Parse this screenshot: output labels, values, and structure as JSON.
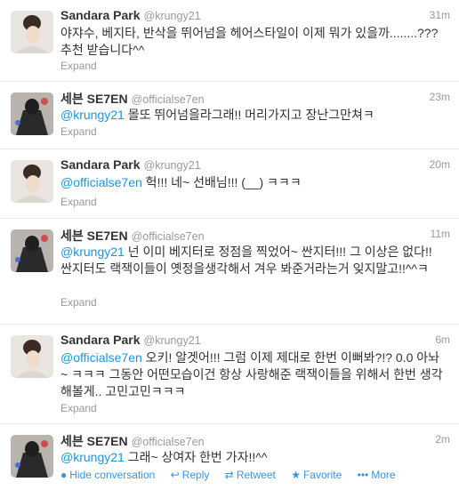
{
  "tweets": [
    {
      "fullname": "Sandara Park",
      "username": "@krungy21",
      "time": "31m",
      "mention": "",
      "text": "야쟈수, 베지타, 반삭을 뛰어넘을 헤어스타일이 이제 뭐가 있을까........??? 추천 받습니다^^",
      "expand": "Expand",
      "avatar": "sandara-avatar"
    },
    {
      "fullname": "세븐 SE7EN",
      "username": "@officialse7en",
      "time": "23m",
      "mention": "@krungy21",
      "text": " 몰또 뛰어넘을라그래!! 머리가지고 장난그만쳐ㅋ",
      "expand": "Expand",
      "avatar": "se7en-avatar"
    },
    {
      "fullname": "Sandara Park",
      "username": "@krungy21",
      "time": "20m",
      "mention": "@officialse7en",
      "text": " 헉!!! 네~ 선배님!!! (__) ㅋㅋㅋ",
      "expand": "Expand",
      "avatar": "sandara-avatar"
    },
    {
      "fullname": "세븐 SE7EN",
      "username": "@officialse7en",
      "time": "11m",
      "mention": "@krungy21",
      "text": " 넌 이미 베지터로 정점을 찍었어~ 싼지터!!! 그 이상은 없다!! 싼지터도 랙잭이들이 옛정을생각해서 겨우 봐준거라는거 잊지말고!!^^ㅋ",
      "expand": "Expand",
      "avatar": "se7en-avatar"
    },
    {
      "fullname": "Sandara Park",
      "username": "@krungy21",
      "time": "6m",
      "mention": "@officialse7en",
      "text": " 오키! 알겟어!!! 그럼 이제 제대로 한번 이뻐봐?!? 0.0 아놔~ ㅋㅋㅋ 그동안 어떤모습이건 항상 사랑해준 랙잭이들을 위해서 한번 생각해볼게.. 고민고민ㅋㅋㅋ",
      "expand": "Expand",
      "avatar": "sandara-avatar"
    },
    {
      "fullname": "세븐 SE7EN",
      "username": "@officialse7en",
      "time": "2m",
      "mention": "@krungy21",
      "text": " 그래~ 상여자 한번 가자!!^^",
      "expand": "",
      "avatar": "se7en-avatar"
    }
  ],
  "actions": {
    "hide": "Hide conversation",
    "reply": "Reply",
    "retweet": "Retweet",
    "favorite": "Favorite",
    "more": "More"
  },
  "colors": {
    "link": "#1b95e0",
    "muted": "#999999",
    "text": "#333333"
  }
}
